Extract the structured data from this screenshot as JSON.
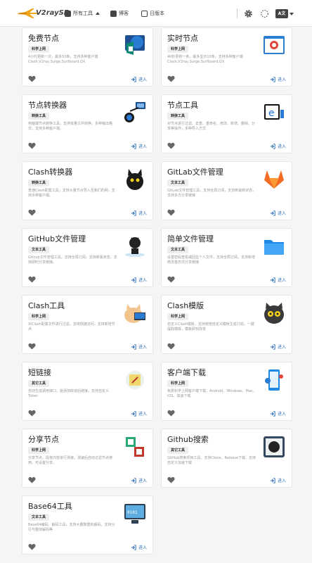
{
  "nav": {
    "logo_text": "V2raySE",
    "all_tools": "所有工具",
    "blog": "博客",
    "changelog": "日版本",
    "lang": "A文"
  },
  "enter_label": "进入",
  "cards": [
    {
      "title": "免费节点",
      "badge": "科学上网",
      "desc": "4小时更新一次，最多50条，支持多种客户端Clash,V2ray,Surge,Surfboard,QX"
    },
    {
      "title": "实时节点",
      "badge": "科学上网",
      "desc": "40秒更新一条，最多显示10条，支持多种客户端Clash,V2ray,Surge,Surfboard,QX"
    },
    {
      "title": "节点转换器",
      "badge": "转换工具",
      "desc": "电脑端节点转换工具，支持批量文件转换、多种输出格式、支持多种客户端。"
    },
    {
      "title": "节点工具",
      "badge": "转换工具",
      "desc": "对节点进行过滤、去重、重命名、修改、新增、删除、分享等操作，多种导入方式"
    },
    {
      "title": "Clash转换器",
      "badge": "转换工具",
      "desc": "普通Clash配置工具，支持大量节点导入至我们的网，支持多种客户端。"
    },
    {
      "title": "GitLab文件管理",
      "badge": "文本工具",
      "desc": "GitLab文件管理工具，支持全局订阅，支持到最新状态，支持多方分享链接"
    },
    {
      "title": "GitHub文件管理",
      "badge": "文本工具",
      "desc": "Github文件管理工具，支持全局订阅，支持新版状态，支持即时分享链接。"
    },
    {
      "title": "简单文件管理",
      "badge": "文本工具",
      "desc": "设置密码查看或回显个人文件，支持全局订阅，支持新增修改各形式分享链接"
    },
    {
      "title": "Clash工具",
      "badge": "科学上网",
      "desc": "对Clash配置文件进行过滤，支持快捷访问，支持新增节点"
    },
    {
      "title": "Clash模版",
      "badge": "科学上网",
      "desc": "自定义Clash模板，支持使用自定义模板生成订阅，一键提取模版，模板即刻改变"
    },
    {
      "title": "短链接",
      "badge": "其它工具",
      "desc": "自动生成调用接口，能添加收敛后链接，支持自定义Token"
    },
    {
      "title": "客户端下载",
      "badge": "科学上网",
      "desc": "免费科学上网客户端下载，Android、Windows、Mac、iOS、加速下载"
    },
    {
      "title": "分享节点",
      "badge": "科学上网",
      "desc": "分享节点，段落内容进行测速，测速后自动过滤节点使用，可设置分享。"
    },
    {
      "title": "Github搜索",
      "badge": "其它工具",
      "desc": "GitHub搜索项目工具，支持Clone、Release下载、支持自定义加速下载"
    },
    {
      "title": "Base64工具",
      "badge": "文本工具",
      "desc": "Base64编码、解码工具，支持大量数据的解码，支持分行与整体解码等"
    }
  ]
}
